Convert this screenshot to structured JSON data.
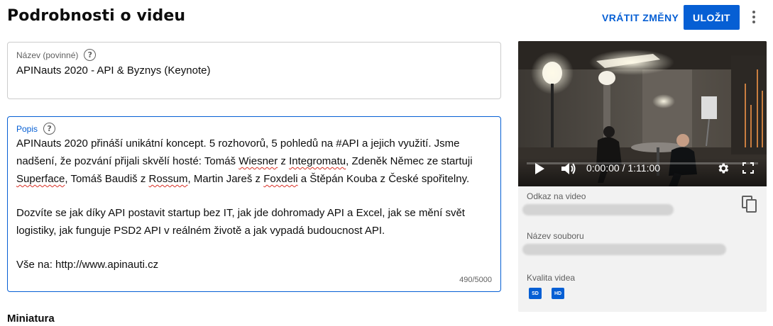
{
  "header": {
    "title": "Podrobnosti o videu",
    "undo_label": "VRÁTIT ZMĚNY",
    "save_label": "ULOŽIT",
    "more_icon": "more-vert-icon"
  },
  "form": {
    "title_field": {
      "label": "Název (povinné)",
      "value": "APINauts 2020 - API & Byznys (Keynote)",
      "help_icon": "help-icon"
    },
    "description_field": {
      "label": "Popis",
      "help_icon": "help-icon",
      "p1": {
        "t1": "APINauts 2020 přináší unikátní koncept. 5 rozhovorů, 5 pohledů na #API a jejich využití. Jsme nadšení, že pozvání přijali skvělí hosté: Tomáš ",
        "w1": "Wiesner",
        "t2": " z ",
        "w2": "Integromatu",
        "t3": ", Zdeněk Němec ze startuji ",
        "w3": "Superface",
        "t4": ", Tomáš Baudiš z ",
        "w4": "Rossum",
        "t5": ", Martin Jareš z ",
        "w5": "Foxdeli",
        "t6": " a Štěpán Kouba z České spořitelny."
      },
      "p2": "Dozvíte se jak díky API postavit startup bez IT, jak jde dohromady API a Excel, jak se mění svět logistiky, jak funguje PSD2 API v reálném životě a jak vypadá budoucnost API.",
      "p3": "Vše na: http://www.apinauti.cz",
      "char_count": "490/5000"
    },
    "thumbnail_heading": "Miniatura"
  },
  "video_panel": {
    "player": {
      "time": "0:00:00 / 1:11:00",
      "icons": [
        "play-icon",
        "volume-icon",
        "gear-icon",
        "fullscreen-icon"
      ]
    },
    "link_label": "Odkaz na video",
    "filename_label": "Název souboru",
    "quality_label": "Kvalita videa",
    "quality_badges": [
      "SD",
      "HD"
    ],
    "copy_icon": "copy-icon",
    "colors": {
      "accent": "#065fd4",
      "panel_bg": "#f2f2f2"
    }
  }
}
